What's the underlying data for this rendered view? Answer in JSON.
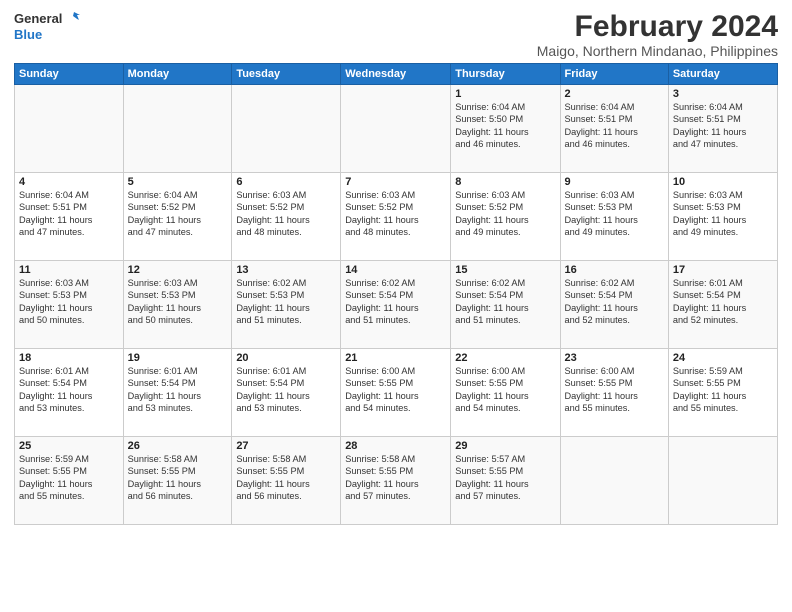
{
  "header": {
    "logo_line1": "General",
    "logo_line2": "Blue",
    "title": "February 2024",
    "subtitle": "Maigo, Northern Mindanao, Philippines"
  },
  "calendar": {
    "days_of_week": [
      "Sunday",
      "Monday",
      "Tuesday",
      "Wednesday",
      "Thursday",
      "Friday",
      "Saturday"
    ],
    "weeks": [
      [
        {
          "day": "",
          "info": ""
        },
        {
          "day": "",
          "info": ""
        },
        {
          "day": "",
          "info": ""
        },
        {
          "day": "",
          "info": ""
        },
        {
          "day": "1",
          "info": "Sunrise: 6:04 AM\nSunset: 5:50 PM\nDaylight: 11 hours\nand 46 minutes."
        },
        {
          "day": "2",
          "info": "Sunrise: 6:04 AM\nSunset: 5:51 PM\nDaylight: 11 hours\nand 46 minutes."
        },
        {
          "day": "3",
          "info": "Sunrise: 6:04 AM\nSunset: 5:51 PM\nDaylight: 11 hours\nand 47 minutes."
        }
      ],
      [
        {
          "day": "4",
          "info": "Sunrise: 6:04 AM\nSunset: 5:51 PM\nDaylight: 11 hours\nand 47 minutes."
        },
        {
          "day": "5",
          "info": "Sunrise: 6:04 AM\nSunset: 5:52 PM\nDaylight: 11 hours\nand 47 minutes."
        },
        {
          "day": "6",
          "info": "Sunrise: 6:03 AM\nSunset: 5:52 PM\nDaylight: 11 hours\nand 48 minutes."
        },
        {
          "day": "7",
          "info": "Sunrise: 6:03 AM\nSunset: 5:52 PM\nDaylight: 11 hours\nand 48 minutes."
        },
        {
          "day": "8",
          "info": "Sunrise: 6:03 AM\nSunset: 5:52 PM\nDaylight: 11 hours\nand 49 minutes."
        },
        {
          "day": "9",
          "info": "Sunrise: 6:03 AM\nSunset: 5:53 PM\nDaylight: 11 hours\nand 49 minutes."
        },
        {
          "day": "10",
          "info": "Sunrise: 6:03 AM\nSunset: 5:53 PM\nDaylight: 11 hours\nand 49 minutes."
        }
      ],
      [
        {
          "day": "11",
          "info": "Sunrise: 6:03 AM\nSunset: 5:53 PM\nDaylight: 11 hours\nand 50 minutes."
        },
        {
          "day": "12",
          "info": "Sunrise: 6:03 AM\nSunset: 5:53 PM\nDaylight: 11 hours\nand 50 minutes."
        },
        {
          "day": "13",
          "info": "Sunrise: 6:02 AM\nSunset: 5:53 PM\nDaylight: 11 hours\nand 51 minutes."
        },
        {
          "day": "14",
          "info": "Sunrise: 6:02 AM\nSunset: 5:54 PM\nDaylight: 11 hours\nand 51 minutes."
        },
        {
          "day": "15",
          "info": "Sunrise: 6:02 AM\nSunset: 5:54 PM\nDaylight: 11 hours\nand 51 minutes."
        },
        {
          "day": "16",
          "info": "Sunrise: 6:02 AM\nSunset: 5:54 PM\nDaylight: 11 hours\nand 52 minutes."
        },
        {
          "day": "17",
          "info": "Sunrise: 6:01 AM\nSunset: 5:54 PM\nDaylight: 11 hours\nand 52 minutes."
        }
      ],
      [
        {
          "day": "18",
          "info": "Sunrise: 6:01 AM\nSunset: 5:54 PM\nDaylight: 11 hours\nand 53 minutes."
        },
        {
          "day": "19",
          "info": "Sunrise: 6:01 AM\nSunset: 5:54 PM\nDaylight: 11 hours\nand 53 minutes."
        },
        {
          "day": "20",
          "info": "Sunrise: 6:01 AM\nSunset: 5:54 PM\nDaylight: 11 hours\nand 53 minutes."
        },
        {
          "day": "21",
          "info": "Sunrise: 6:00 AM\nSunset: 5:55 PM\nDaylight: 11 hours\nand 54 minutes."
        },
        {
          "day": "22",
          "info": "Sunrise: 6:00 AM\nSunset: 5:55 PM\nDaylight: 11 hours\nand 54 minutes."
        },
        {
          "day": "23",
          "info": "Sunrise: 6:00 AM\nSunset: 5:55 PM\nDaylight: 11 hours\nand 55 minutes."
        },
        {
          "day": "24",
          "info": "Sunrise: 5:59 AM\nSunset: 5:55 PM\nDaylight: 11 hours\nand 55 minutes."
        }
      ],
      [
        {
          "day": "25",
          "info": "Sunrise: 5:59 AM\nSunset: 5:55 PM\nDaylight: 11 hours\nand 55 minutes."
        },
        {
          "day": "26",
          "info": "Sunrise: 5:58 AM\nSunset: 5:55 PM\nDaylight: 11 hours\nand 56 minutes."
        },
        {
          "day": "27",
          "info": "Sunrise: 5:58 AM\nSunset: 5:55 PM\nDaylight: 11 hours\nand 56 minutes."
        },
        {
          "day": "28",
          "info": "Sunrise: 5:58 AM\nSunset: 5:55 PM\nDaylight: 11 hours\nand 57 minutes."
        },
        {
          "day": "29",
          "info": "Sunrise: 5:57 AM\nSunset: 5:55 PM\nDaylight: 11 hours\nand 57 minutes."
        },
        {
          "day": "",
          "info": ""
        },
        {
          "day": "",
          "info": ""
        }
      ]
    ]
  }
}
